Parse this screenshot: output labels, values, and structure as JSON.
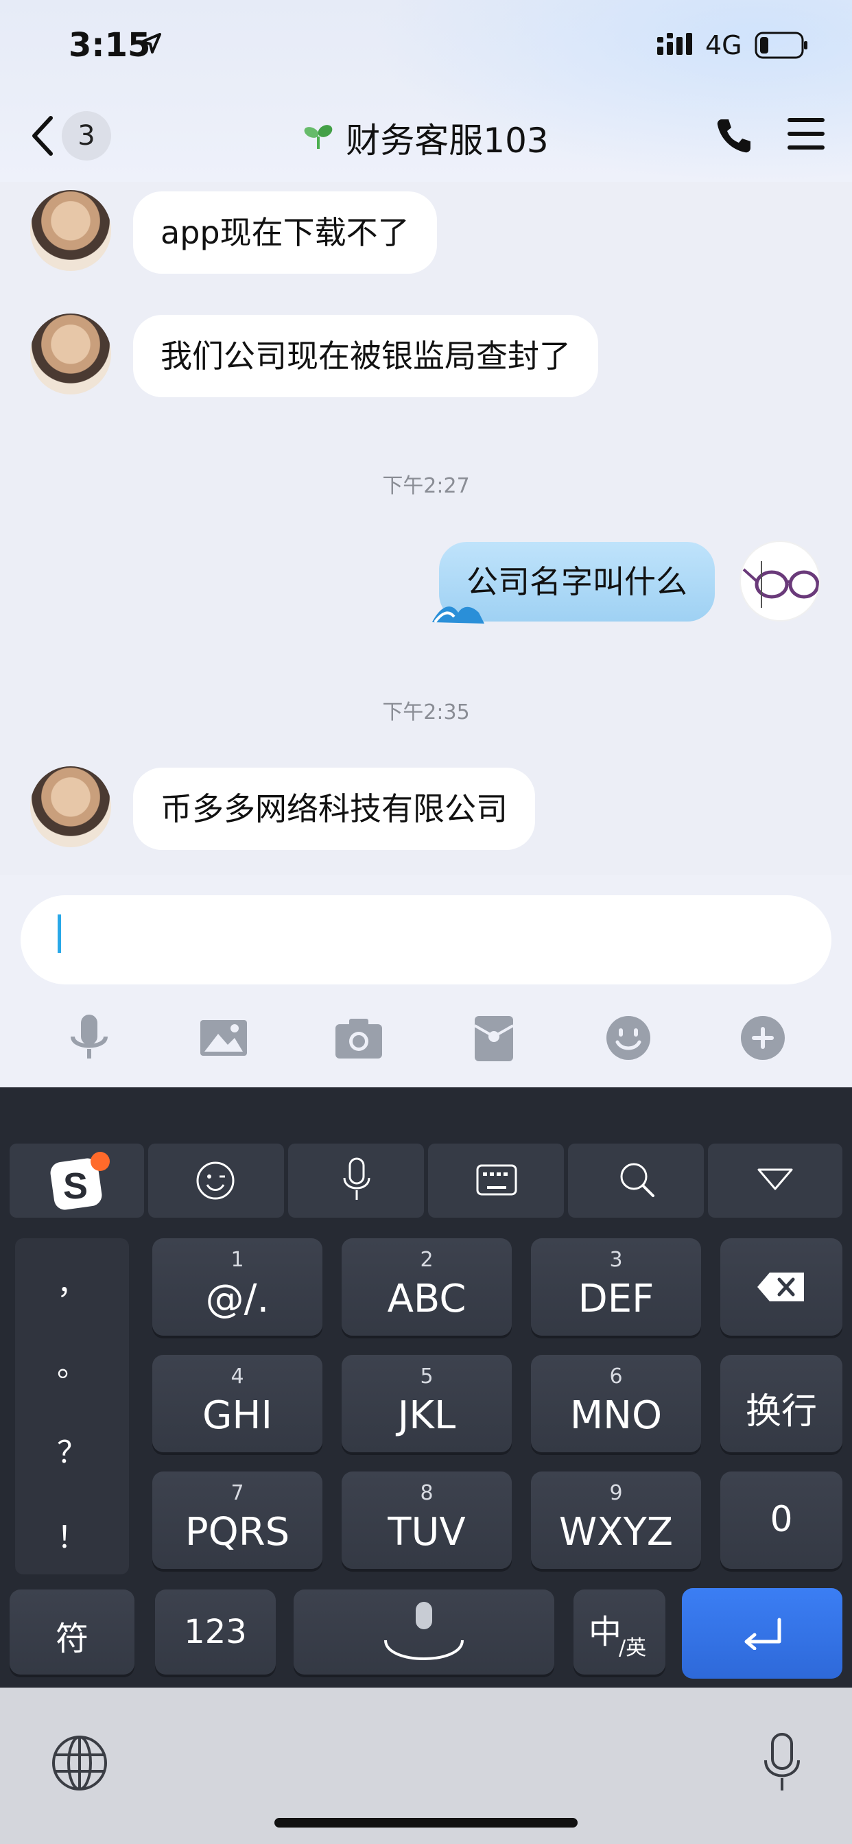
{
  "status_bar": {
    "time": "3:15",
    "network": "4G"
  },
  "header": {
    "back_count": "3",
    "title": "财务客服103"
  },
  "messages": [
    {
      "from": "other",
      "text": "app现在下载不了"
    },
    {
      "from": "other",
      "text": "我们公司现在被银监局查封了"
    },
    {
      "type": "time",
      "text": "下午2:27"
    },
    {
      "from": "me",
      "text": "公司名字叫什么"
    },
    {
      "type": "time",
      "text": "下午2:35"
    },
    {
      "from": "other",
      "text": "币多多网络科技有限公司"
    }
  ],
  "input": {
    "value": ""
  },
  "toolbar_icons": [
    "microphone-icon",
    "image-icon",
    "camera-icon",
    "red-packet-icon",
    "emoji-icon",
    "plus-icon"
  ],
  "keyboard": {
    "top_row_icons": [
      "sogou-logo-icon",
      "emoji-face-icon",
      "microphone-icon",
      "keyboard-icon",
      "search-icon",
      "collapse-icon"
    ],
    "punctuation": [
      "，",
      "。",
      "？",
      "！"
    ],
    "keys": [
      {
        "num": "1",
        "letters": "@/."
      },
      {
        "num": "2",
        "letters": "ABC"
      },
      {
        "num": "3",
        "letters": "DEF"
      },
      {
        "num": "4",
        "letters": "GHI"
      },
      {
        "num": "5",
        "letters": "JKL"
      },
      {
        "num": "6",
        "letters": "MNO"
      },
      {
        "num": "7",
        "letters": "PQRS"
      },
      {
        "num": "8",
        "letters": "TUV"
      },
      {
        "num": "9",
        "letters": "WXYZ"
      }
    ],
    "newline_label": "换行",
    "zero_label": "0",
    "symbol_label": "符",
    "num_label": "123",
    "lang_main": "中",
    "lang_sub": "/英"
  },
  "colors": {
    "accent": "#2f6fe0",
    "caret": "#29a8e8",
    "bubble_me": "#aad8f5"
  }
}
